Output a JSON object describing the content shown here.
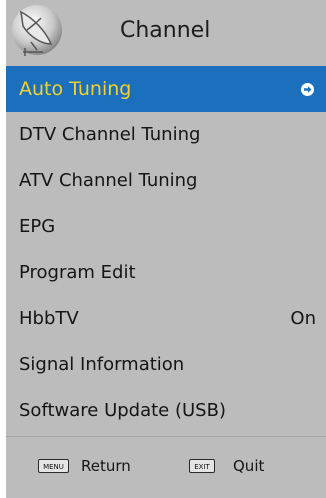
{
  "header": {
    "title": "Channel",
    "icon": "satellite-dish-icon"
  },
  "menu": {
    "items": [
      {
        "label": "Auto Tuning",
        "value": "",
        "selected": true
      },
      {
        "label": "DTV Channel Tuning",
        "value": ""
      },
      {
        "label": "ATV Channel Tuning",
        "value": ""
      },
      {
        "label": "EPG",
        "value": ""
      },
      {
        "label": "Program Edit",
        "value": ""
      },
      {
        "label": "HbbTV",
        "value": "On"
      },
      {
        "label": "Signal Information",
        "value": ""
      },
      {
        "label": "Software Update (USB)",
        "value": ""
      }
    ]
  },
  "footer": {
    "menu_key": "MENU",
    "return_label": "Return",
    "exit_key": "EXIT",
    "quit_label": "Quit"
  },
  "colors": {
    "panel_bg": "#bcbcbc",
    "selected_bg": "#1b6fbd",
    "selected_text": "#f2d22b",
    "text": "#151515"
  }
}
